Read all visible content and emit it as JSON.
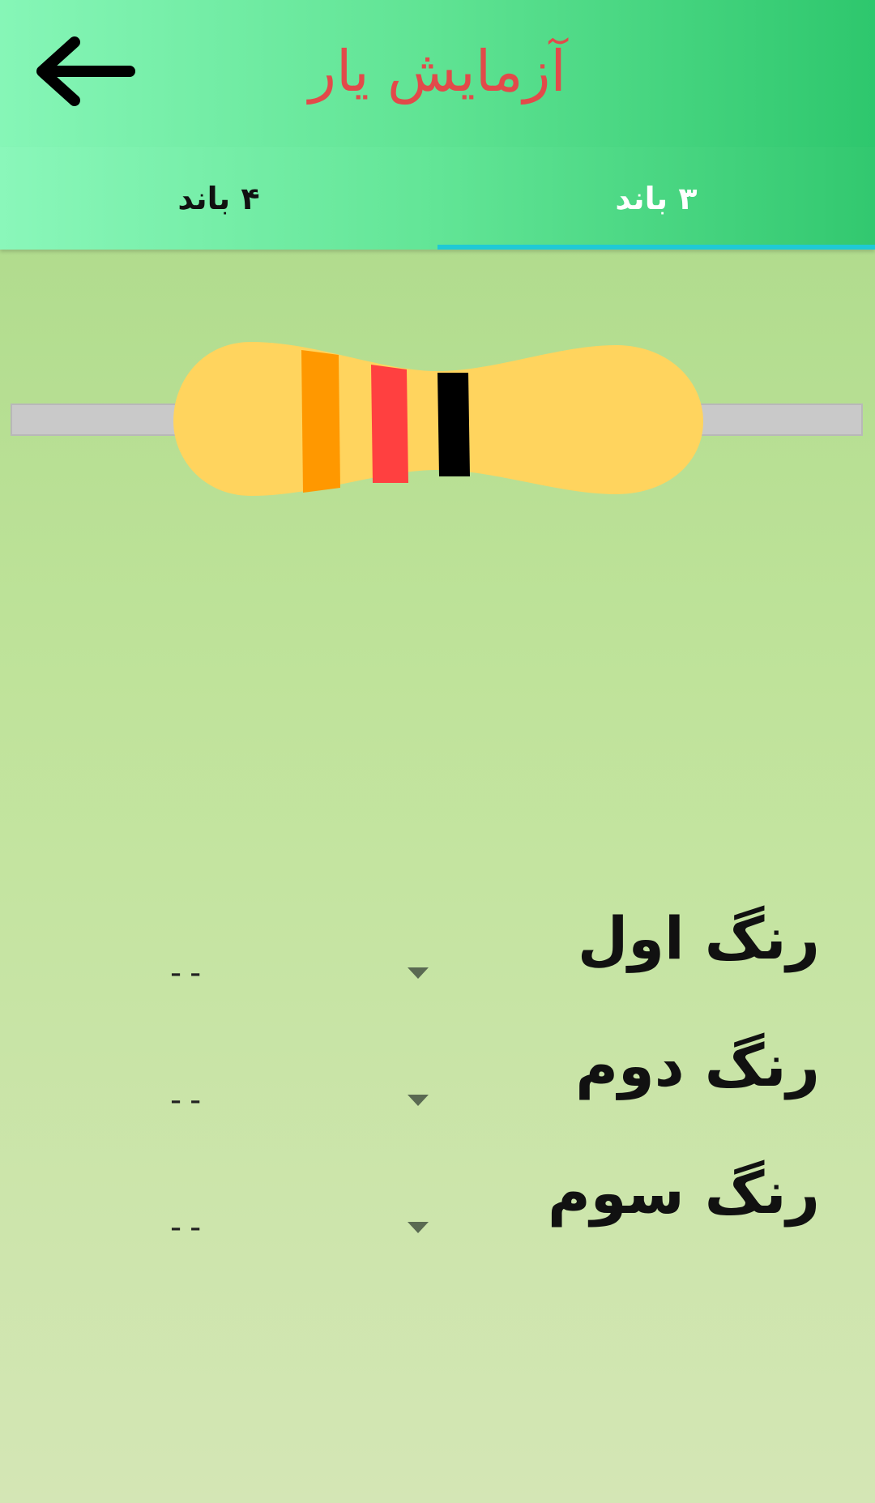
{
  "appbar": {
    "title": "آزمایش یار",
    "back_icon": "arrow-left-icon"
  },
  "tabs": [
    {
      "label": "۴ باند",
      "selected": false
    },
    {
      "label": "۳ باند",
      "selected": true
    }
  ],
  "resistor": {
    "body_color": "#ffd45e",
    "lead_color": "#c9c9c9",
    "bands": [
      {
        "color_name": "orange",
        "hex": "#ff9800"
      },
      {
        "color_name": "red",
        "hex": "#ff4040"
      },
      {
        "color_name": "black",
        "hex": "#000000"
      }
    ]
  },
  "color_rows": [
    {
      "label": "رنگ اول",
      "value": "--"
    },
    {
      "label": "رنگ دوم",
      "value": "--"
    },
    {
      "label": "رنگ سوم",
      "value": "--"
    }
  ],
  "colors": {
    "title": "#e24a4a",
    "tab_indicator": "#1fc9d6"
  }
}
